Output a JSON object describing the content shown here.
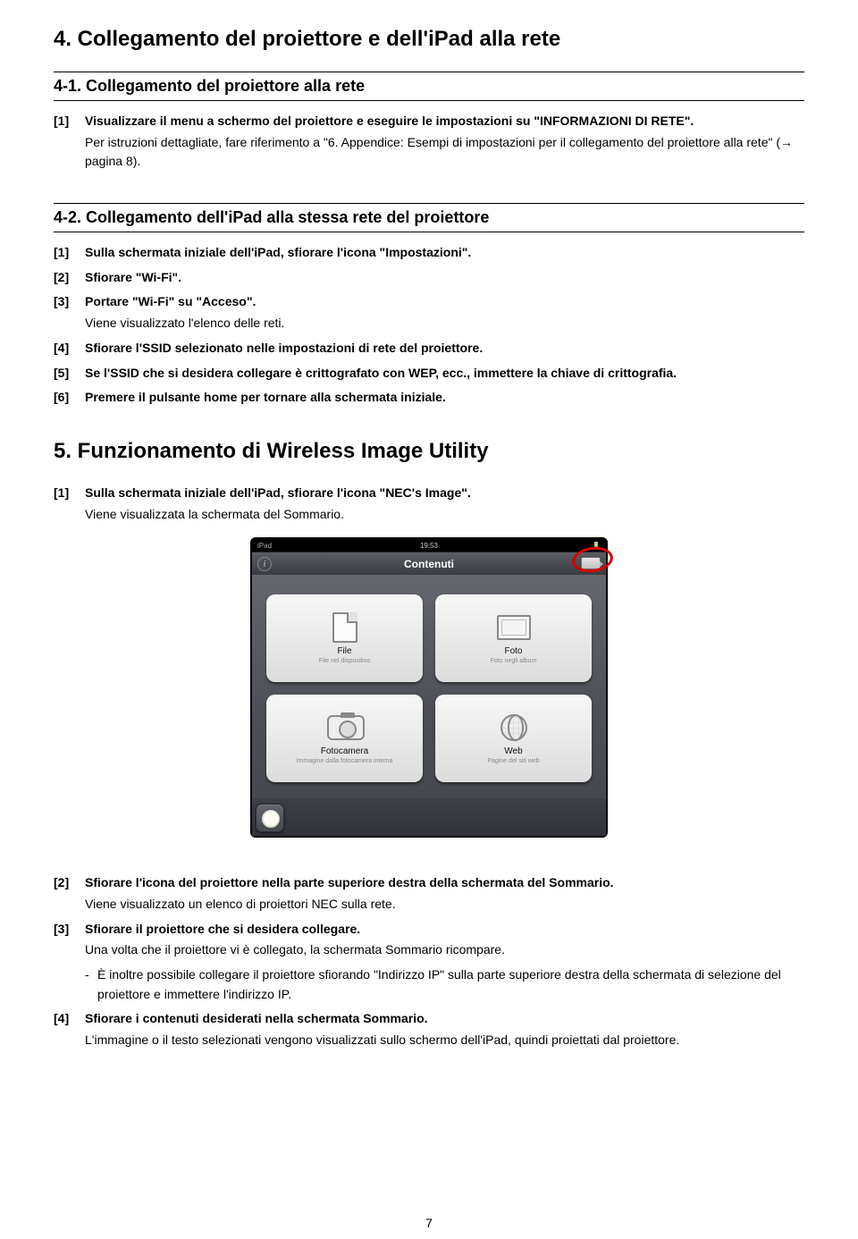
{
  "page_number": "7",
  "sec4": {
    "title": "4. Collegamento del proiettore e dell'iPad alla rete",
    "s41": {
      "title": "4-1. Collegamento del proiettore alla rete",
      "step1": {
        "num": "[1]",
        "bold": "Visualizzare il menu a schermo del proiettore e eseguire le impostazioni su \"INFORMAZIONI DI RETE\".",
        "note_a": "Per istruzioni dettagliate, fare riferimento a \"6. Appendice: Esempi di impostazioni per il collegamento del proiettore alla rete\" (",
        "note_b": " pagina 8)."
      }
    },
    "s42": {
      "title": "4-2. Collegamento dell'iPad alla stessa rete del proiettore",
      "step1": {
        "num": "[1]",
        "txt": "Sulla schermata iniziale dell'iPad, sfiorare l'icona \"Impostazioni\"."
      },
      "step2": {
        "num": "[2]",
        "txt": "Sfiorare \"Wi-Fi\"."
      },
      "step3": {
        "num": "[3]",
        "txt": "Portare \"Wi-Fi\" su \"Acceso\".",
        "note": "Viene visualizzato l'elenco delle reti."
      },
      "step4": {
        "num": "[4]",
        "txt": "Sfiorare l'SSID selezionato nelle impostazioni di rete del proiettore."
      },
      "step5": {
        "num": "[5]",
        "txt": "Se l'SSID che si desidera collegare è crittografato con WEP, ecc., immettere la chiave di crittografia."
      },
      "step6": {
        "num": "[6]",
        "txt": "Premere il pulsante home per tornare alla schermata iniziale."
      }
    }
  },
  "sec5": {
    "title": "5. Funzionamento di Wireless Image Utility",
    "step1": {
      "num": "[1]",
      "txt": "Sulla schermata iniziale dell'iPad, sfiorare l'icona \"NEC's Image\".",
      "note": "Viene visualizzata la schermata del Sommario."
    },
    "step2": {
      "num": "[2]",
      "txt": "Sfiorare l'icona del proiettore nella parte superiore destra della schermata del Sommario.",
      "note": "Viene visualizzato un elenco di proiettori NEC sulla rete."
    },
    "step3": {
      "num": "[3]",
      "txt": "Sfiorare il proiettore che si desidera collegare.",
      "note": "Una volta che il proiettore vi è collegato, la schermata Sommario ricompare.",
      "dash": "-",
      "sub": "È inoltre possibile collegare il proiettore sfiorando \"Indirizzo IP\" sulla parte superiore destra della schermata di selezione del proiettore e immettere l'indirizzo IP."
    },
    "step4": {
      "num": "[4]",
      "txt": "Sfiorare i contenuti desiderati nella schermata Sommario.",
      "note": "L'immagine o il testo selezionati vengono visualizzati sullo schermo dell'iPad, quindi proiettati dal proiettore."
    }
  },
  "ipad": {
    "status_left": "iPad",
    "status_time": "19:53",
    "nav_title": "Contenuti",
    "info_glyph": "i",
    "cards": {
      "file": {
        "label": "File",
        "sub": "File nel dispositivo"
      },
      "photo": {
        "label": "Foto",
        "sub": "Foto negli album"
      },
      "cam": {
        "label": "Fotocamera",
        "sub": "Immagine dalla fotocamera interna"
      },
      "web": {
        "label": "Web",
        "sub": "Pagine del siti web"
      }
    }
  }
}
